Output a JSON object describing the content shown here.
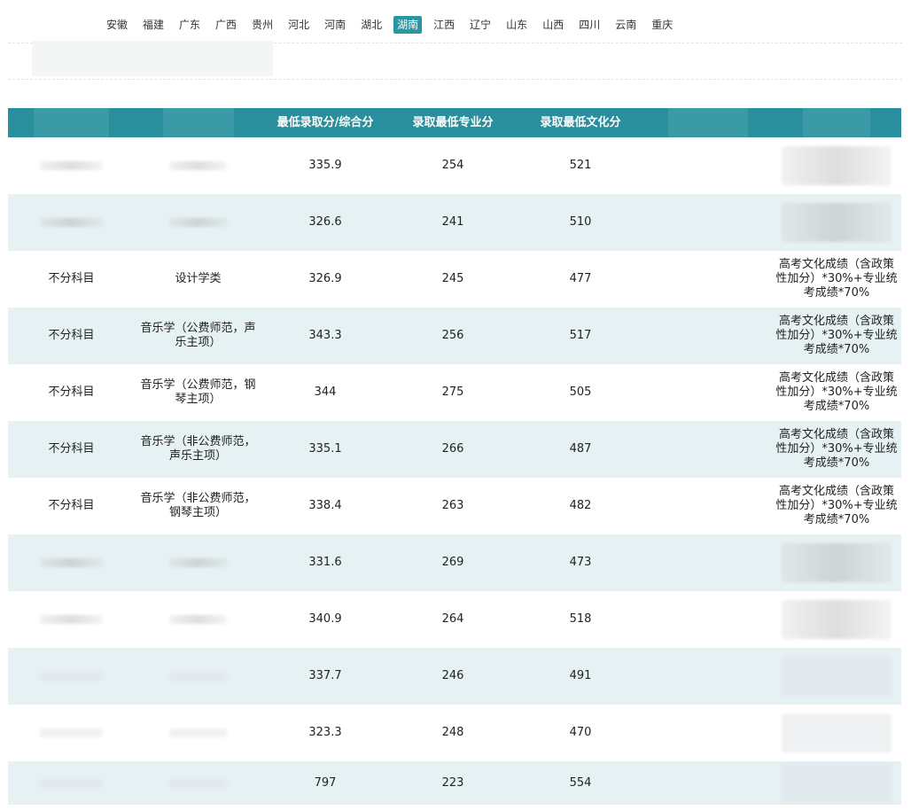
{
  "provinces": {
    "items": [
      "安徽",
      "福建",
      "广东",
      "广西",
      "贵州",
      "河北",
      "河南",
      "湖北",
      "湖南",
      "江西",
      "辽宁",
      "山东",
      "山西",
      "四川",
      "云南",
      "重庆"
    ],
    "active_index": 8
  },
  "table": {
    "headers": [
      "",
      "",
      "最低录取分/综合分",
      "录取最低专业分",
      "录取最低文化分",
      "",
      ""
    ],
    "rows": [
      {
        "subject": "",
        "major": "",
        "min_total": "335.9",
        "min_major": "254",
        "min_culture": "521",
        "formula": ""
      },
      {
        "subject": "",
        "major": "",
        "min_total": "326.6",
        "min_major": "241",
        "min_culture": "510",
        "formula": ""
      },
      {
        "subject": "不分科目",
        "major": "设计学类",
        "min_total": "326.9",
        "min_major": "245",
        "min_culture": "477",
        "formula": "高考文化成绩（含政策性加分）*30%+专业统考成绩*70%"
      },
      {
        "subject": "不分科目",
        "major": "音乐学（公费师范，声乐主项）",
        "min_total": "343.3",
        "min_major": "256",
        "min_culture": "517",
        "formula": "高考文化成绩（含政策性加分）*30%+专业统考成绩*70%"
      },
      {
        "subject": "不分科目",
        "major": "音乐学（公费师范，钢琴主项）",
        "min_total": "344",
        "min_major": "275",
        "min_culture": "505",
        "formula": "高考文化成绩（含政策性加分）*30%+专业统考成绩*70%"
      },
      {
        "subject": "不分科目",
        "major": "音乐学（非公费师范，声乐主项）",
        "min_total": "335.1",
        "min_major": "266",
        "min_culture": "487",
        "formula": "高考文化成绩（含政策性加分）*30%+专业统考成绩*70%"
      },
      {
        "subject": "不分科目",
        "major": "音乐学（非公费师范，钢琴主项）",
        "min_total": "338.4",
        "min_major": "263",
        "min_culture": "482",
        "formula": "高考文化成绩（含政策性加分）*30%+专业统考成绩*70%"
      },
      {
        "subject": "",
        "major": "",
        "min_total": "331.6",
        "min_major": "269",
        "min_culture": "473",
        "formula": ""
      },
      {
        "subject": "",
        "major": "",
        "min_total": "340.9",
        "min_major": "264",
        "min_culture": "518",
        "formula": ""
      },
      {
        "subject": "",
        "major": "",
        "min_total": "337.7",
        "min_major": "246",
        "min_culture": "491",
        "formula": ""
      },
      {
        "subject": "",
        "major": "",
        "min_total": "323.3",
        "min_major": "248",
        "min_culture": "470",
        "formula": ""
      },
      {
        "subject": "",
        "major": "",
        "min_total": "797",
        "min_major": "223",
        "min_culture": "554",
        "formula": ""
      }
    ]
  },
  "colors": {
    "accent": "#2a96a3",
    "header_bg": "#2a8f9c",
    "alt_row": "#e6f1f4"
  }
}
